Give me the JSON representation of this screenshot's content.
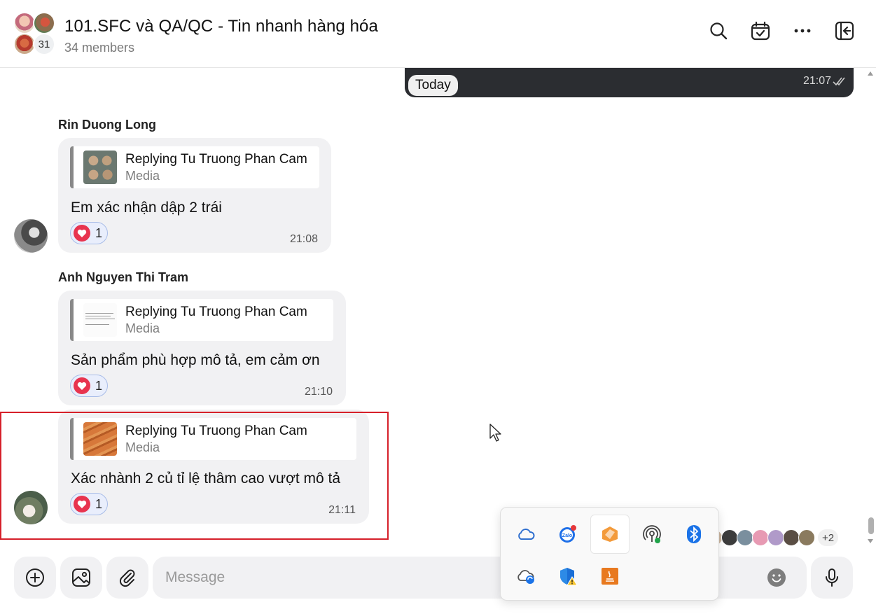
{
  "header": {
    "title": "101.SFC và QA/QC - Tin nhanh hàng hóa",
    "members": "34 members",
    "avatar_overflow_count": "31",
    "icons": [
      "search-icon",
      "calendar-check-icon",
      "more-icon",
      "panel-toggle-icon"
    ]
  },
  "chat": {
    "previous_message_time": "21:07",
    "date_divider": "Today",
    "messages": [
      {
        "sender": "Rin Duong Long",
        "reply_title": "Replying Tu Truong Phan Cam",
        "reply_sub": "Media",
        "text": "Em xác nhận dập 2 trái",
        "reaction_count": "1",
        "time": "21:08"
      },
      {
        "sender": "Anh Nguyen Thi Tram",
        "reply_title": "Replying Tu Truong Phan Cam",
        "reply_sub": "Media",
        "text": "Sản phẩm phù hợp mô tả, em cảm ơn",
        "reaction_count": "1",
        "time": "21:10"
      },
      {
        "sender": "",
        "reply_title": "Replying Tu Truong Phan Cam",
        "reply_sub": "Media",
        "text": "Xác nhành 2 củ tỉ lệ thâm cao vượt mô tả",
        "reaction_count": "1",
        "time": "21:11"
      }
    ],
    "seen_more": "+2"
  },
  "tray": {
    "icons": [
      "onedrive-cloud-icon",
      "zalo-icon",
      "orange-app-icon",
      "hotspot-icon",
      "bluetooth-icon",
      "cloud-sync-icon",
      "security-shield-icon",
      "java-icon"
    ]
  },
  "composer": {
    "placeholder": "Message"
  },
  "colors": {
    "accent_blue": "#0068ff",
    "heart_red": "#e8344f",
    "highlight_red": "#d6202a",
    "dark_bubble": "#2b2d31"
  }
}
